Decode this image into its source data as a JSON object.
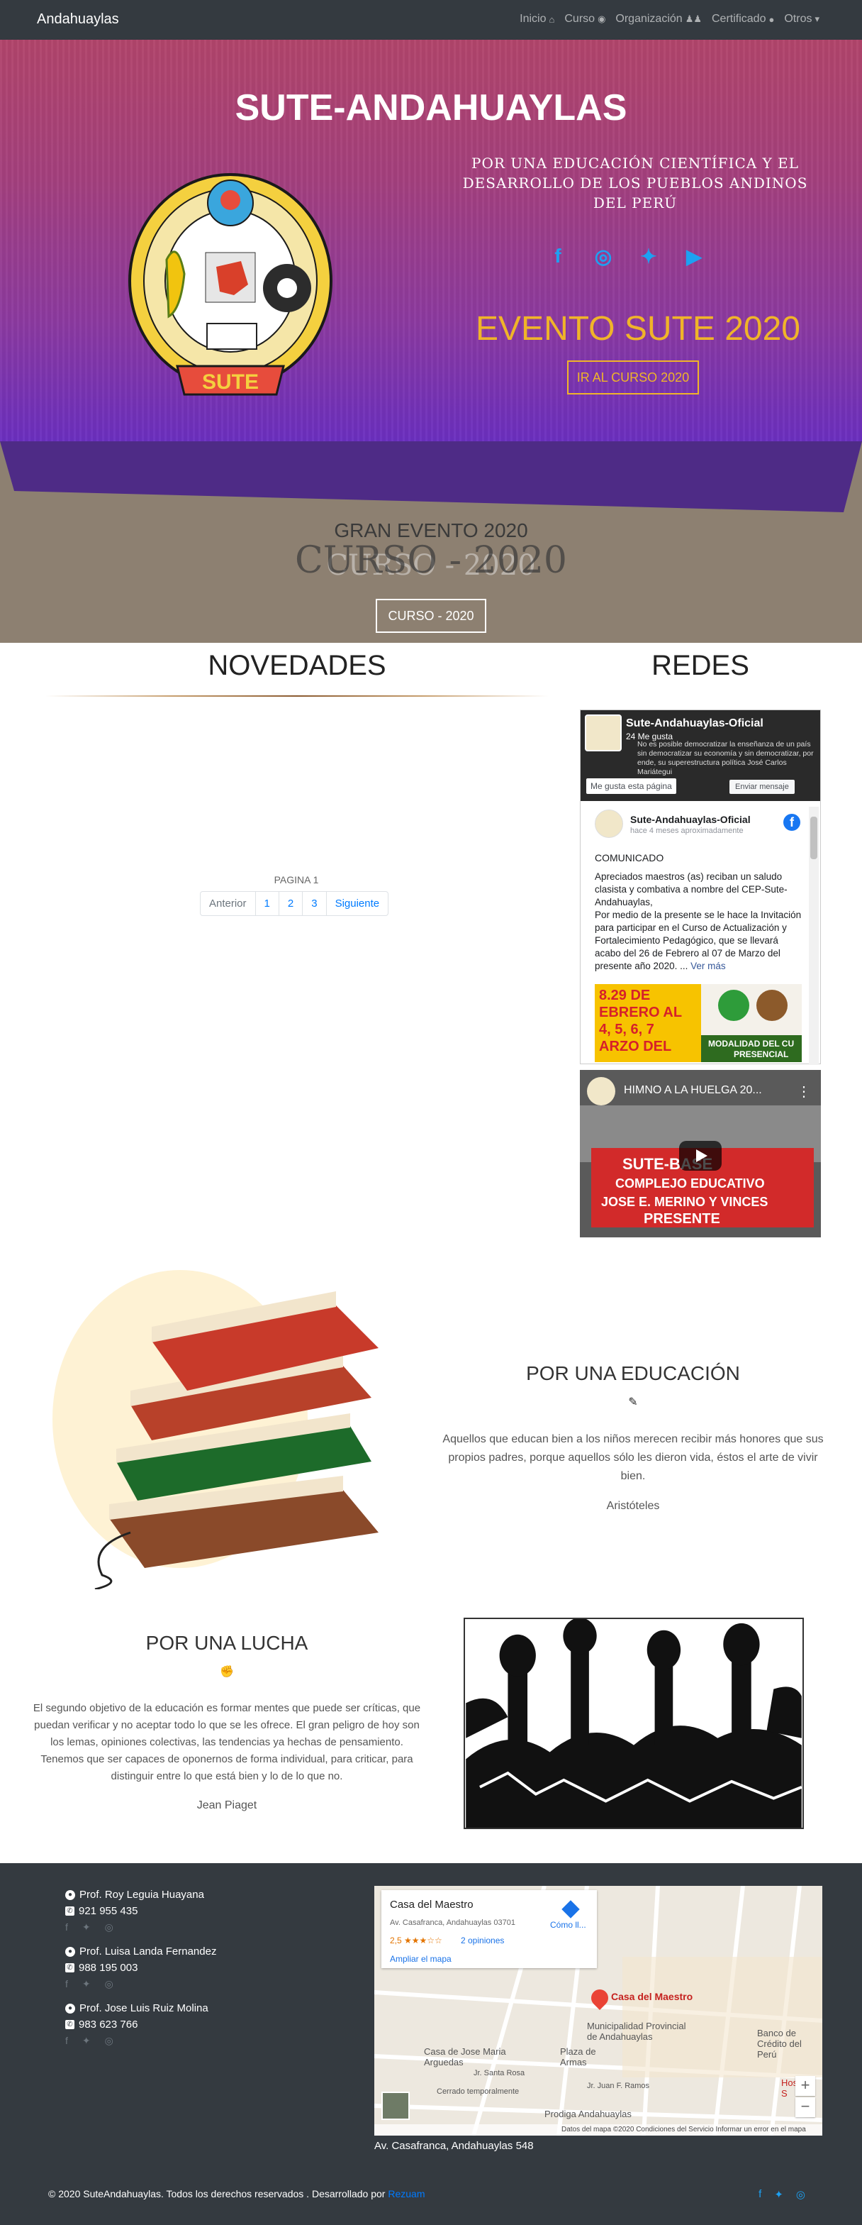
{
  "navbar": {
    "brand": "Andahuaylas",
    "items": [
      {
        "label": "Inicio",
        "icon": "home-icon"
      },
      {
        "label": "Curso",
        "icon": "globe-icon"
      },
      {
        "label": "Organización",
        "icon": "users-icon"
      },
      {
        "label": "Certificado",
        "icon": "circle-icon"
      },
      {
        "label": "Otros",
        "icon": "chevron-down-icon"
      }
    ]
  },
  "hero": {
    "title": "SUTE-ANDAHUAYLAS",
    "motto": "POR UNA EDUCACIÓN CIENTÍFICA Y EL DESARROLLO DE LOS PUEBLOS ANDINOS DEL PERÚ",
    "event_title": "EVENTO SUTE 2020",
    "event_button": "IR AL CURSO 2020",
    "social": [
      "facebook-icon",
      "instagram-icon",
      "twitter-icon",
      "youtube-icon"
    ],
    "logo_text": "SUTE"
  },
  "curso": {
    "subtitle": "GRAN EVENTO 2020",
    "title": "CURSO - 2020",
    "button": "CURSO - 2020"
  },
  "novedades": {
    "title": "NOVEDADES",
    "pagina": "PAGINA 1",
    "pager": [
      "Anterior",
      "1",
      "2",
      "3",
      "Siguiente"
    ]
  },
  "redes": {
    "title": "REDES",
    "fb": {
      "page_name": "Sute-Andahuaylas-Oficial",
      "likes": "24 Me gusta",
      "desc": "No es posible democratizar la enseñanza de un país sin democratizar su economía y sin democratizar, por ende, su superestructura política José Carlos Mariátegui",
      "like_button": "Me gusta esta página",
      "message_button": "Enviar mensaje",
      "post_name": "Sute-Andahuaylas-Oficial",
      "post_time": "hace 4 meses aproximadamente",
      "post_head": "COMUNICADO",
      "post_text": "Apreciados maestros (as) reciban un saludo clasista y combativa a nombre del CEP-Sute-Andahuaylas,\nPor medio de la presente se le hace la Invitación para participar en el Curso de Actualización y Fortalecimiento Pedagógico, que se llevará acabo del 26 de Febrero al 07 de Marzo del presente año 2020. ...",
      "post_more": "Ver más",
      "post_image_lines": [
        "8.29 DE",
        "EBRERO AL",
        "4, 5, 6, 7",
        "ARZO DEL"
      ],
      "post_image_caption": "MODALIDAD DEL CU",
      "post_image_caption2": "PRESENCIAL"
    },
    "yt": {
      "title": "HIMNO A LA HUELGA 20...",
      "banner_lines": [
        "SUTE-BASE",
        "COMPLEJO EDUCATIVO",
        "JOSE E. MERINO Y VINCES",
        "PRESENTE"
      ]
    }
  },
  "educacion": {
    "title": "POR UNA EDUCACIÓN",
    "text": "Aquellos que educan bien a los niños merecen recibir más honores que sus propios padres, porque aquellos sólo les dieron vida, éstos el arte de vivir bien.",
    "author": "Aristóteles"
  },
  "lucha": {
    "title": "POR UNA LUCHA",
    "text": "El segundo objetivo de la educación es formar mentes que puede ser críticas, que puedan verificar y no aceptar todo lo que se les ofrece. El gran peligro de hoy son los lemas, opiniones colectivas, las tendencias ya hechas de pensamiento. Tenemos que ser capaces de oponernos de forma individual, para criticar, para distinguir entre lo que está bien y lo de lo que no.",
    "author": "Jean Piaget"
  },
  "footer": {
    "contacts": [
      {
        "name": "Prof. Roy Leguia Huayana",
        "phone": "921 955 435"
      },
      {
        "name": "Prof. Luisa Landa Fernandez",
        "phone": "988 195 003"
      },
      {
        "name": "Prof. Jose Luis Ruiz Molina",
        "phone": "983 623 766"
      }
    ],
    "map": {
      "place": "Casa del Maestro",
      "address": "Av. Casafranca, Andahuaylas 03701",
      "rating": "2,5 ★★★☆☆",
      "reviews": "2 opiniones",
      "enlarge": "Ampliar el mapa",
      "directions": "Cómo ll...",
      "pin_label": "Casa del Maestro",
      "labels": [
        "Municipalidad Provincial de Andahuaylas",
        "Plaza de Armas",
        "Casa de Jose Maria Arguedas",
        "Banco de Crédito del Perú",
        "Hospital S",
        "Prodiga Andahuaylas",
        "Jr. Santa Rosa",
        "Jr. Juan F. Ramos",
        "Cerrado temporalmente"
      ],
      "bottom": "Datos del mapa ©2020    Condiciones del Servicio    Informar un error en el mapa",
      "zoom_in": "+",
      "zoom_out": "−"
    },
    "map_address": "Av. Casafranca, Andahuaylas 548",
    "copyright": "© 2020 SuteAndahuaylas. Todos los derechos reservados . Desarrollado por",
    "developer": "Rezuam"
  }
}
